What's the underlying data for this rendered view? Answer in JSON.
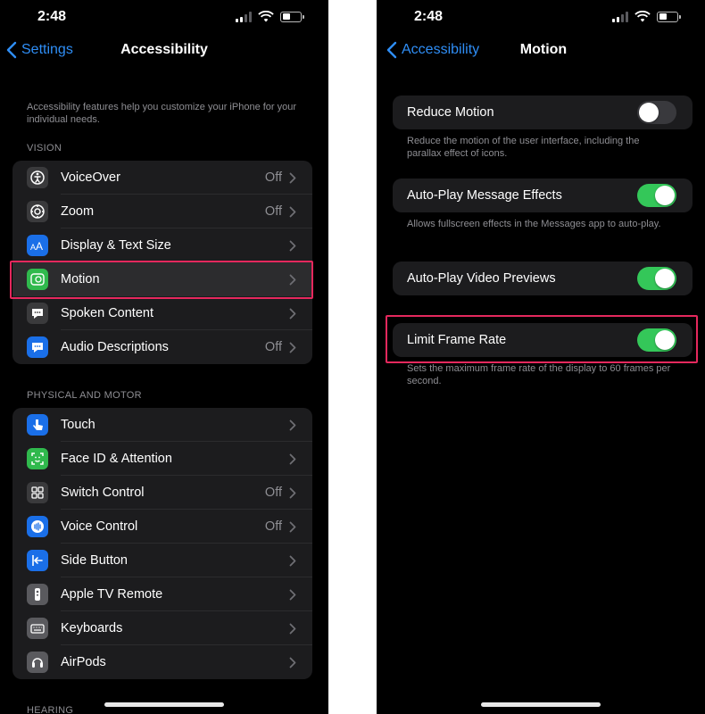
{
  "left": {
    "status_time": "2:48",
    "nav": {
      "back_label": "Settings",
      "title": "Accessibility"
    },
    "intro": "Accessibility features help you customize your iPhone for your individual needs.",
    "vision_header": "VISION",
    "vision_items": [
      {
        "label": "VoiceOver",
        "value": "Off",
        "icon": "voiceover-icon",
        "color": "#3a3a3c"
      },
      {
        "label": "Zoom",
        "value": "Off",
        "icon": "zoom-icon",
        "color": "#3a3a3c"
      },
      {
        "label": "Display & Text Size",
        "value": "",
        "icon": "text-size-icon",
        "color": "#1a6fe8"
      },
      {
        "label": "Motion",
        "value": "",
        "icon": "motion-icon",
        "color": "#30b94d"
      },
      {
        "label": "Spoken Content",
        "value": "",
        "icon": "speech-bubble-icon",
        "color": "#3a3a3c"
      },
      {
        "label": "Audio Descriptions",
        "value": "Off",
        "icon": "audio-description-icon",
        "color": "#1a6fe8"
      }
    ],
    "physical_header": "PHYSICAL AND MOTOR",
    "physical_items": [
      {
        "label": "Touch",
        "value": "",
        "icon": "hand-pointer-icon",
        "color": "#1a6fe8"
      },
      {
        "label": "Face ID & Attention",
        "value": "",
        "icon": "face-id-icon",
        "color": "#30b94d"
      },
      {
        "label": "Switch Control",
        "value": "Off",
        "icon": "switch-control-icon",
        "color": "#3a3a3c"
      },
      {
        "label": "Voice Control",
        "value": "Off",
        "icon": "voice-control-icon",
        "color": "#1a6fe8"
      },
      {
        "label": "Side Button",
        "value": "",
        "icon": "side-button-icon",
        "color": "#1a6fe8"
      },
      {
        "label": "Apple TV Remote",
        "value": "",
        "icon": "remote-icon",
        "color": "#5a5a5e"
      },
      {
        "label": "Keyboards",
        "value": "",
        "icon": "keyboard-icon",
        "color": "#5a5a5e"
      },
      {
        "label": "AirPods",
        "value": "",
        "icon": "airpods-icon",
        "color": "#5a5a5e"
      }
    ],
    "hearing_header": "HEARING"
  },
  "right": {
    "status_time": "2:48",
    "nav": {
      "back_label": "Accessibility",
      "title": "Motion"
    },
    "settings": [
      {
        "label": "Reduce Motion",
        "on": false,
        "footnote": "Reduce the motion of the user interface, including the parallax effect of icons."
      },
      {
        "label": "Auto-Play Message Effects",
        "on": true,
        "footnote": "Allows fullscreen effects in the Messages app to auto-play."
      },
      {
        "label": "Auto-Play Video Previews",
        "on": true,
        "footnote": ""
      },
      {
        "label": "Limit Frame Rate",
        "on": true,
        "footnote": "Sets the maximum frame rate of the display to 60 frames per second."
      }
    ]
  },
  "colors": {
    "accent": "#2f8ef6",
    "toggle_on": "#34c759",
    "highlight": "#e5285d",
    "cell": "#1c1c1e"
  }
}
